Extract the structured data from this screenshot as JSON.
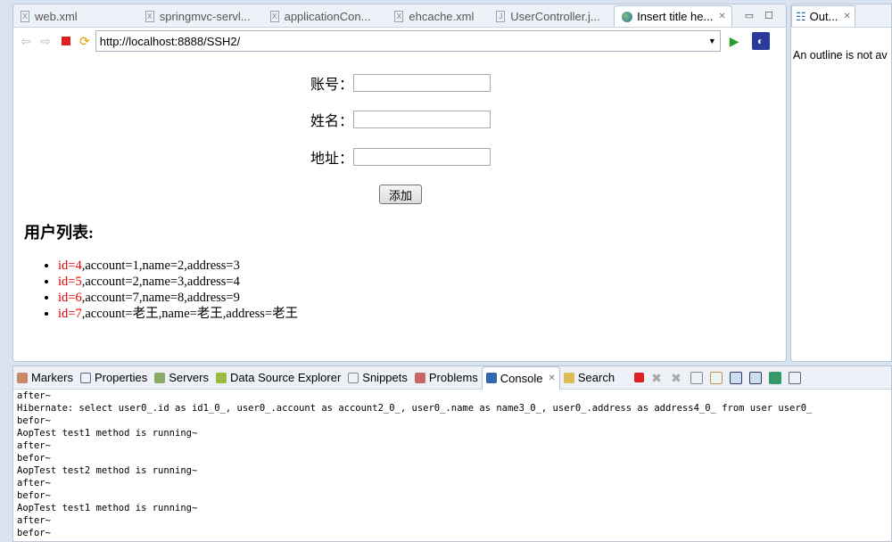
{
  "editor": {
    "tabs": [
      {
        "label": "web.xml",
        "icon": "xml-file-icon"
      },
      {
        "label": "springmvc-servl...",
        "icon": "xml-file-icon"
      },
      {
        "label": "applicationCon...",
        "icon": "xml-file-icon"
      },
      {
        "label": "ehcache.xml",
        "icon": "xml-file-icon"
      },
      {
        "label": "UserController.j...",
        "icon": "java-file-icon"
      }
    ],
    "active_tab": "Insert title he...",
    "url": "http://localhost:8888/SSH2/"
  },
  "form": {
    "account_label": "账号：",
    "name_label": "姓名：",
    "address_label": "地址：",
    "account_value": "",
    "name_value": "",
    "address_value": "",
    "submit_label": "添加"
  },
  "list": {
    "heading": "用户列表:",
    "items": [
      {
        "id": "id=4",
        "rest": ",account=1,name=2,address=3"
      },
      {
        "id": "id=5",
        "rest": ",account=2,name=3,address=4"
      },
      {
        "id": "id=6",
        "rest": ",account=7,name=8,address=9"
      },
      {
        "id": "id=7",
        "rest": ",account=老王,name=老王,address=老王"
      }
    ]
  },
  "outline": {
    "tab": "Out...",
    "message": "An outline is not av"
  },
  "bottom": {
    "tabs": [
      "Markers",
      "Properties",
      "Servers",
      "Data Source Explorer",
      "Snippets",
      "Problems",
      "Console",
      "Search"
    ],
    "active": "Console"
  },
  "console": [
    "after~",
    "Hibernate: select user0_.id as id1_0_, user0_.account as account2_0_, user0_.name as name3_0_, user0_.address as address4_0_ from user user0_",
    "befor~",
    "AopTest test1 method is running~",
    "after~",
    "befor~",
    "AopTest test2 method is running~",
    "after~",
    "befor~",
    "AopTest test1 method is running~",
    "after~",
    "befor~"
  ]
}
